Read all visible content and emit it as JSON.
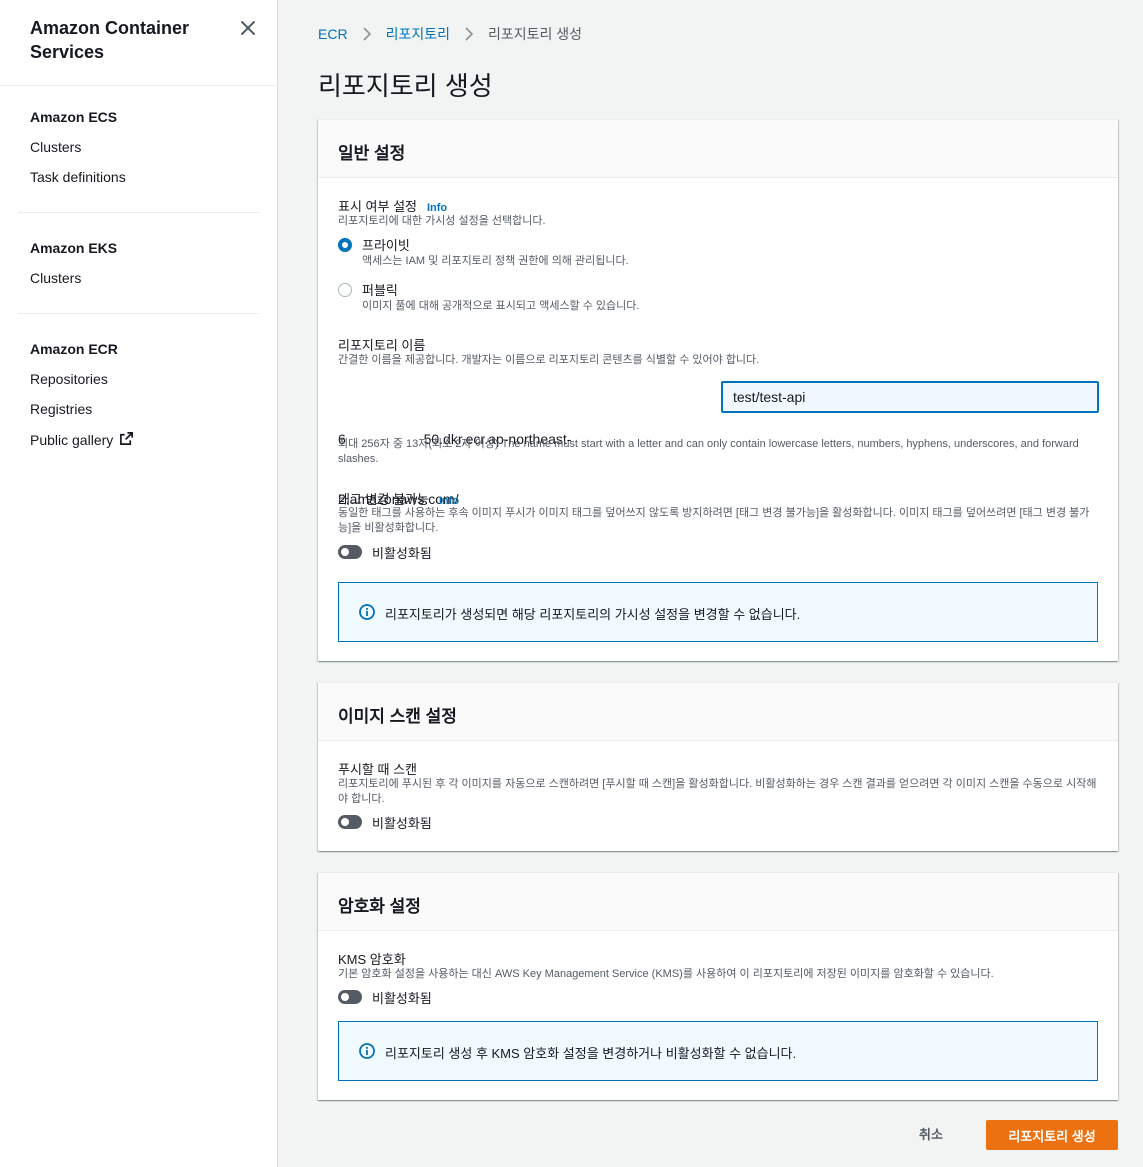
{
  "sidebar": {
    "title": "Amazon Container Services",
    "sections": [
      {
        "heading": "Amazon ECS",
        "items": [
          "Clusters",
          "Task definitions"
        ]
      },
      {
        "heading": "Amazon EKS",
        "items": [
          "Clusters"
        ]
      },
      {
        "heading": "Amazon ECR",
        "items": [
          "Repositories",
          "Registries",
          "Public gallery"
        ]
      }
    ]
  },
  "breadcrumb": {
    "items": [
      "ECR",
      "리포지토리",
      "리포지토리 생성"
    ]
  },
  "page": {
    "title": "리포지토리 생성"
  },
  "general": {
    "heading": "일반 설정",
    "visibility": {
      "label": "표시 여부 설정",
      "info": "Info",
      "desc": "리포지토리에 대한 가시성 설정을 선택합니다.",
      "options": [
        {
          "label": "프라이빗",
          "desc": "액세스는 IAM 및 리포지토리 정책 권한에 의해 관리됩니다.",
          "selected": true
        },
        {
          "label": "퍼블릭",
          "desc": "이미지 풀에 대해 공개적으로 표시되고 액세스할 수 있습니다.",
          "selected": false
        }
      ]
    },
    "repo_name": {
      "label": "리포지토리 이름",
      "desc": "간결한 이름을 제공합니다. 개발자는 이름으로 리포지토리 콘텐츠를 식별할 수 있어야 합니다.",
      "prefix_line1": "6                    50.dkr.ecr.ap-northeast-",
      "prefix_line2": "2.amazonaws.com/",
      "value": "test/test-api",
      "constraint": "최대 256자 중 13자(최소 2자 이상) The name must start with a letter and can only contain lowercase letters, numbers, hyphens, underscores, and forward slashes."
    },
    "immutability": {
      "label": "태그 변경 불가능",
      "info": "Info",
      "desc": "동일한 태그를 사용하는 후속 이미지 푸시가 이미지 태그를 덮어쓰지 않도록 방지하려면 [태그 변경 불가능]을 활성화합니다. 이미지 태그를 덮어쓰려면 [태그 변경 불가능]을 비활성화합니다.",
      "state": "비활성화됨"
    },
    "alert": "리포지토리가 생성되면 해당 리포지토리의 가시성 설정을 변경할 수 없습니다."
  },
  "scan": {
    "heading": "이미지 스캔 설정",
    "label": "푸시할 때 스캔",
    "desc": "리포지토리에 푸시된 후 각 이미지를 자동으로 스캔하려면 [푸시할 때 스캔]을 활성화합니다. 비활성화하는 경우 스캔 결과를 얻으려면 각 이미지 스캔을 수동으로 시작해야 합니다.",
    "state": "비활성화됨"
  },
  "encryption": {
    "heading": "암호화 설정",
    "label": "KMS 암호화",
    "desc": "기본 암호화 설정을 사용하는 대신 AWS Key Management Service (KMS)를 사용하여 이 리포지토리에 저장된 이미지를 암호화할 수 있습니다.",
    "state": "비활성화됨",
    "alert": "리포지토리 생성 후 KMS 암호화 설정을 변경하거나 비활성화할 수 없습니다."
  },
  "actions": {
    "cancel": "취소",
    "submit": "리포지토리 생성"
  },
  "colors": {
    "accent": "#0073bb",
    "primary_button": "#ec7211"
  }
}
